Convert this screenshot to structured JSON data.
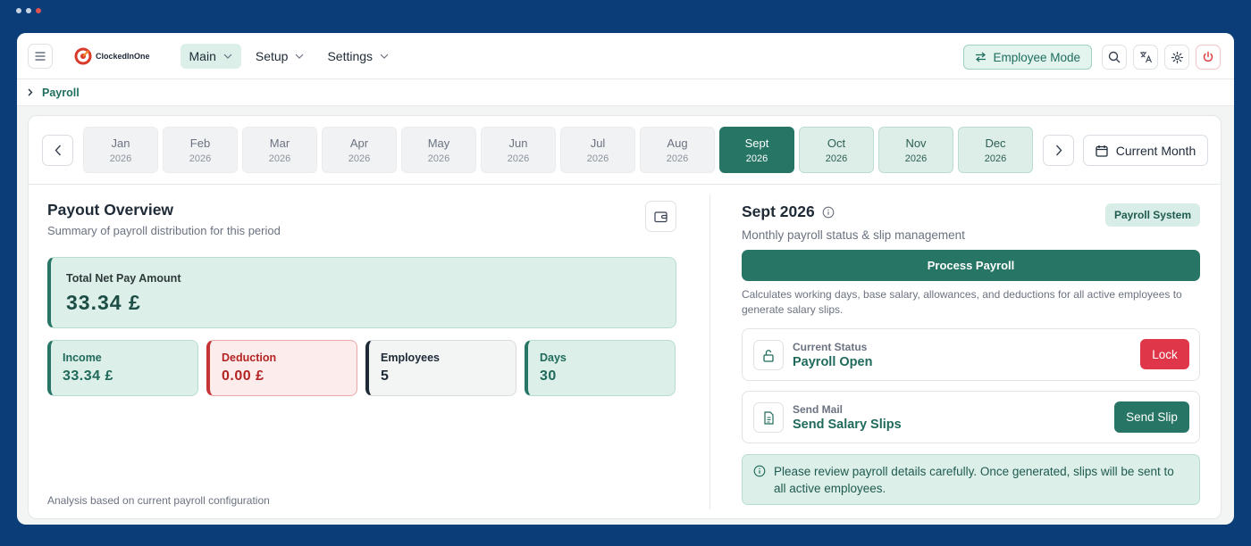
{
  "window_dots": [
    "#c7d3e3",
    "#c7d3e3",
    "#e05252"
  ],
  "app": {
    "logo_text": "ClockedInOne"
  },
  "nav": [
    {
      "label": "Main",
      "active": true
    },
    {
      "label": "Setup",
      "active": false
    },
    {
      "label": "Settings",
      "active": false
    }
  ],
  "header": {
    "employee_mode_label": "Employee Mode"
  },
  "breadcrumb": {
    "current": "Payroll"
  },
  "months": [
    {
      "name": "Jan",
      "year": "2026",
      "state": "past"
    },
    {
      "name": "Feb",
      "year": "2026",
      "state": "past"
    },
    {
      "name": "Mar",
      "year": "2026",
      "state": "past"
    },
    {
      "name": "Apr",
      "year": "2026",
      "state": "past"
    },
    {
      "name": "May",
      "year": "2026",
      "state": "past"
    },
    {
      "name": "Jun",
      "year": "2026",
      "state": "past"
    },
    {
      "name": "Jul",
      "year": "2026",
      "state": "past"
    },
    {
      "name": "Aug",
      "year": "2026",
      "state": "past"
    },
    {
      "name": "Sept",
      "year": "2026",
      "state": "selected"
    },
    {
      "name": "Oct",
      "year": "2026",
      "state": "upcoming"
    },
    {
      "name": "Nov",
      "year": "2026",
      "state": "upcoming"
    },
    {
      "name": "Dec",
      "year": "2026",
      "state": "upcoming"
    }
  ],
  "current_month_label": "Current Month",
  "overview": {
    "title": "Payout Overview",
    "subtitle": "Summary of payroll distribution for this period",
    "total_label": "Total Net Pay Amount",
    "total_value": "33.34 £",
    "stats": {
      "income": {
        "label": "Income",
        "value": "33.34 £"
      },
      "deduction": {
        "label": "Deduction",
        "value": "0.00 £"
      },
      "employees": {
        "label": "Employees",
        "value": "5"
      },
      "days": {
        "label": "Days",
        "value": "30"
      }
    },
    "footnote": "Analysis based on current payroll configuration"
  },
  "payroll": {
    "period": "Sept 2026",
    "badge": "Payroll System",
    "subtitle": "Monthly payroll status & slip management",
    "process_label": "Process Payroll",
    "process_description": "Calculates working days, base salary, allowances, and deductions for all active employees to generate salary slips.",
    "status_label": "Current Status",
    "status_value": "Payroll Open",
    "lock_label": "Lock",
    "mail_label": "Send Mail",
    "mail_value": "Send Salary Slips",
    "send_slip_label": "Send Slip",
    "notice": "Please review payroll details carefully. Once generated, slips will be sent to all active employees."
  },
  "colors": {
    "brand": "#267565",
    "danger": "#e0364a",
    "background": "#0b3d79"
  }
}
